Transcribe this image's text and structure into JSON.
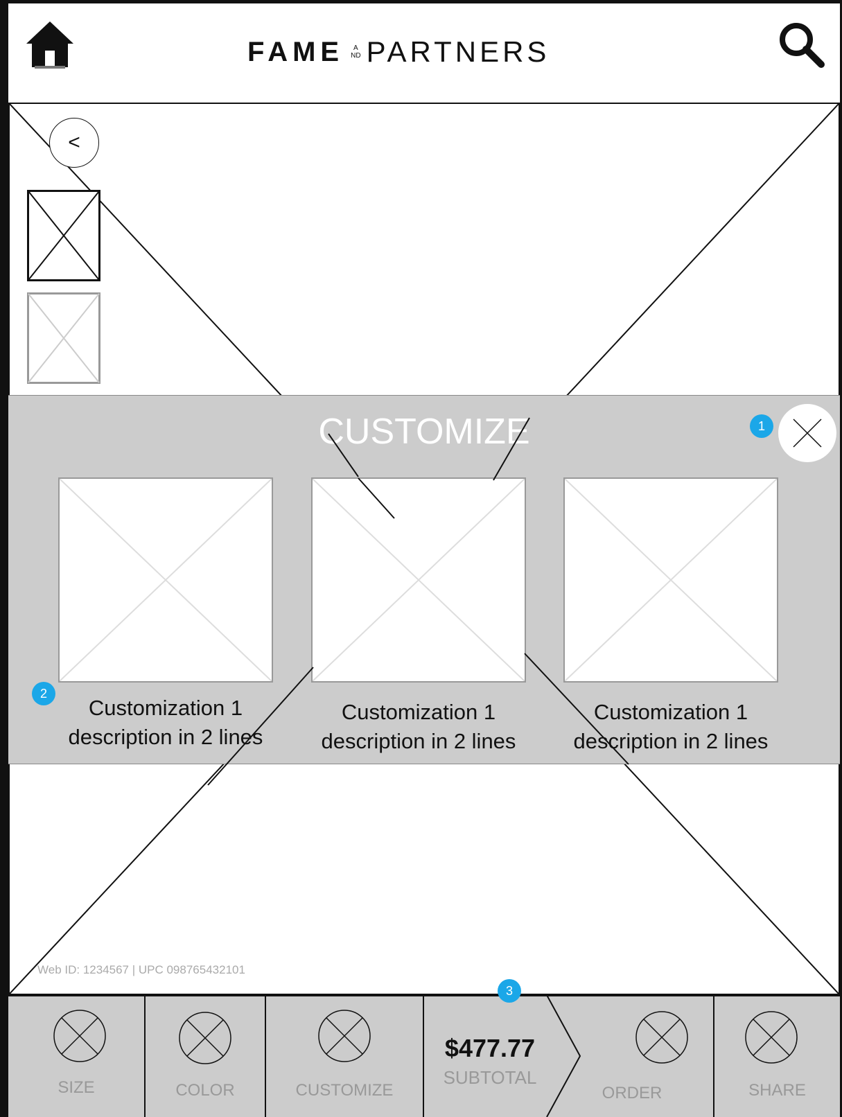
{
  "header": {
    "brand_left": "FAME",
    "brand_and_top": "A",
    "brand_and_mid": "N",
    "brand_and_bot": "D",
    "brand_right": "PARTNERS",
    "home_icon": "home-icon",
    "search_icon": "search-icon"
  },
  "product": {
    "back_label": "<",
    "web_id": "Web ID: 1234567  | UPC 098765432101"
  },
  "customize": {
    "title": "CUSTOMIZE",
    "items": [
      {
        "line1": "Customization 1",
        "line2": "description in 2 lines"
      },
      {
        "line1": "Customization 1",
        "line2": "description in 2 lines"
      },
      {
        "line1": "Customization 1",
        "line2": "description in 2 lines"
      }
    ]
  },
  "badges": {
    "close": "1",
    "item": "2",
    "subtotal": "3"
  },
  "bottom_bar": {
    "size_label": "SIZE",
    "color_label": "COLOR",
    "customize_label": "CUSTOMIZE",
    "price": "$477.77",
    "subtotal_label": "SUBTOTAL",
    "order_label": "ORDER",
    "share_label": "SHARE"
  }
}
